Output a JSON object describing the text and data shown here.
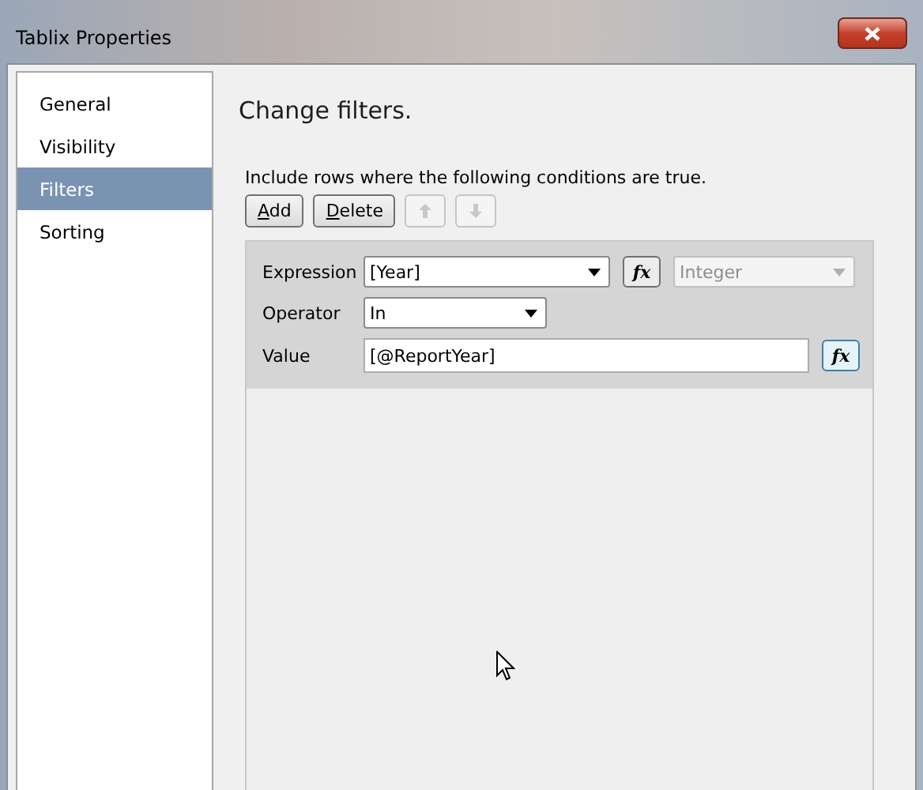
{
  "window": {
    "title": "Tablix Properties"
  },
  "sidebar": {
    "items": [
      {
        "label": "General",
        "selected": false
      },
      {
        "label": "Visibility",
        "selected": false
      },
      {
        "label": "Filters",
        "selected": true
      },
      {
        "label": "Sorting",
        "selected": false
      }
    ]
  },
  "heading": "Change filters.",
  "instruction": "Include rows where the following conditions are true.",
  "toolbar": {
    "buttons": [
      {
        "kind": "text",
        "label": "Add",
        "disabled": false
      },
      {
        "kind": "text",
        "label": "Delete",
        "disabled": false
      },
      {
        "kind": "up",
        "disabled": true
      },
      {
        "kind": "down",
        "disabled": true
      }
    ]
  },
  "filter": {
    "expression": {
      "label": "Expression",
      "value": "[Year]",
      "fx": "fx",
      "type": "Integer"
    },
    "operator": {
      "label": "Operator",
      "value": "In"
    },
    "value": {
      "label": "Value",
      "value": "[@ReportYear]",
      "fx": "fx"
    }
  }
}
